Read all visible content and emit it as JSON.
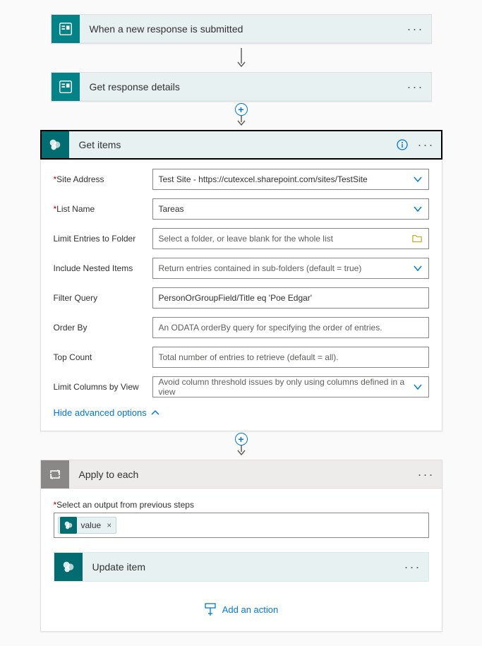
{
  "step1": {
    "title": "When a new response is submitted"
  },
  "step2": {
    "title": "Get response details"
  },
  "step3": {
    "title": "Get items",
    "params": {
      "siteAddress": {
        "label": "Site Address",
        "value": "Test Site - https://cutexcel.sharepoint.com/sites/TestSite"
      },
      "listName": {
        "label": "List Name",
        "value": "Tareas"
      },
      "limitFolder": {
        "label": "Limit Entries to Folder",
        "placeholder": "Select a folder, or leave blank for the whole list"
      },
      "nested": {
        "label": "Include Nested Items",
        "placeholder": "Return entries contained in sub-folders (default = true)"
      },
      "filter": {
        "label": "Filter Query",
        "value": "PersonOrGroupField/Title eq 'Poe Edgar'"
      },
      "orderBy": {
        "label": "Order By",
        "placeholder": "An ODATA orderBy query for specifying the order of entries."
      },
      "topCount": {
        "label": "Top Count",
        "placeholder": "Total number of entries to retrieve (default = all)."
      },
      "limitCols": {
        "label": "Limit Columns by View",
        "placeholder": "Avoid column threshold issues by only using columns defined in a view"
      }
    },
    "hideAdvanced": "Hide advanced options"
  },
  "step4": {
    "title": "Apply to each",
    "outputLabel": "Select an output from previous steps",
    "tokenLabel": "value"
  },
  "step5": {
    "title": "Update item"
  },
  "addAction": "Add an action"
}
